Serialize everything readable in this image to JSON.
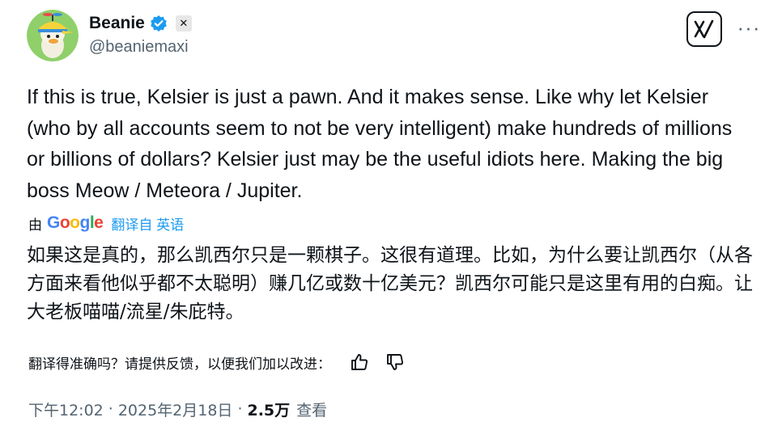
{
  "author": {
    "display_name": "Beanie",
    "handle": "@beaniemaxi",
    "avatar_icon": "duck-with-propeller-cap-avatar",
    "verified_icon": "verified-badge-icon",
    "affiliate_badge": "✕"
  },
  "header_actions": {
    "grok_icon": "grok-icon",
    "more_icon": "more-icon",
    "more_label": "···"
  },
  "tweet": {
    "text": "If this is true, Kelsier is just a pawn. And it makes sense. Like why let Kelsier (who by all accounts seem to not be very intelligent) make hundreds of millions or billions of dollars? Kelsier just may be the useful idiots here. Making the big boss Meow / Meteora / Jupiter."
  },
  "translation": {
    "by_label": "由",
    "provider": "Google",
    "link_label": "翻译自 英语",
    "text": "如果这是真的，那么凯西尔只是一颗棋子。这很有道理。比如，为什么要让凯西尔（从各方面来看他似乎都不太聪明）赚几亿或数十亿美元？凯西尔可能只是这里有用的白痴。让大老板喵喵/流星/朱庇特。",
    "feedback_prompt": "翻译得准确吗？请提供反馈，以便我们加以改进：",
    "thumbs_up_icon": "thumbs-up-icon",
    "thumbs_down_icon": "thumbs-down-icon"
  },
  "meta": {
    "time": "下午12:02",
    "separator": "·",
    "date": "2025年2月18日",
    "views_count": "2.5万",
    "views_label": "查看"
  },
  "colors": {
    "text_primary": "#0f1419",
    "text_secondary": "#536471",
    "link_blue": "#1d9bf0",
    "verified_blue": "#1d9bf0"
  }
}
